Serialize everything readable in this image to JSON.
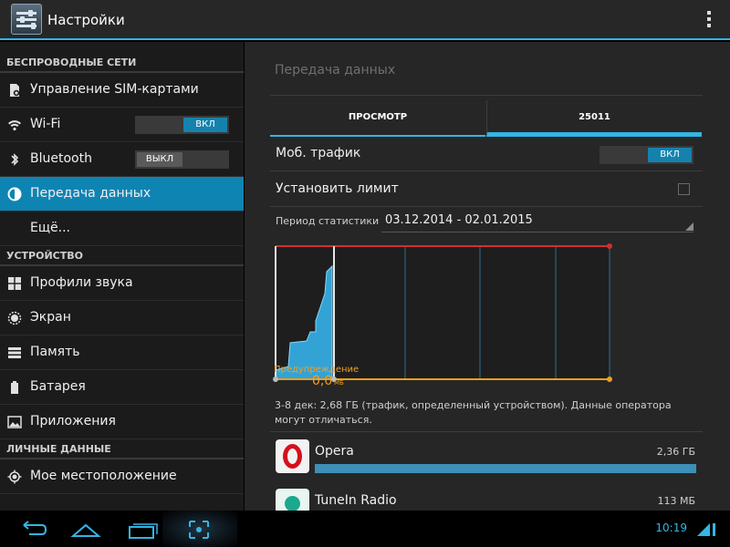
{
  "actionbar": {
    "title": "Настройки"
  },
  "sidebar": {
    "sections": {
      "wireless": "БЕСПРОВОДНЫЕ СЕТИ",
      "device": "УСТРОЙСТВО",
      "personal": "ЛИЧНЫЕ ДАННЫЕ"
    },
    "items": [
      {
        "label": "Управление SIM-картами",
        "icon": "sim-card-icon"
      },
      {
        "label": "Wi-Fi",
        "icon": "wifi-icon",
        "toggle": "ВКЛ"
      },
      {
        "label": "Bluetooth",
        "icon": "bluetooth-icon",
        "toggle": "ВЫКЛ"
      },
      {
        "label": "Передача данных",
        "icon": "data-usage-icon",
        "active": true
      },
      {
        "label": "Ещё..."
      },
      {
        "label": "Профили звука",
        "icon": "sound-profiles-icon"
      },
      {
        "label": "Экран",
        "icon": "display-icon"
      },
      {
        "label": "Память",
        "icon": "storage-icon"
      },
      {
        "label": "Батарея",
        "icon": "battery-icon"
      },
      {
        "label": "Приложения",
        "icon": "apps-icon"
      },
      {
        "label": "Мое местоположение",
        "icon": "location-icon"
      }
    ]
  },
  "main": {
    "title": "Передача данных",
    "tabs": [
      {
        "label": "ПРОСМОТР"
      },
      {
        "label": "25011"
      }
    ],
    "mobile_data": {
      "label": "Моб. трафик",
      "toggle": "ВКЛ"
    },
    "set_limit": {
      "label": "Установить лимит",
      "checked": false
    },
    "period": {
      "label": "Период статистики",
      "value": "03.12.2014 - 02.01.2015"
    },
    "chart": {
      "warning_label": "Предупреждение",
      "warning_value": "0,0",
      "warning_unit": "МБ"
    },
    "note": "3-8 дек: 2,68 ГБ (трафик, определенный устройством). Данные оператора могут отличаться.",
    "apps": [
      {
        "name": "Opera",
        "size": "2,36 ГБ",
        "share": 1.0
      },
      {
        "name": "TuneIn Radio",
        "size": "113 МБ",
        "share": 0.05
      }
    ]
  },
  "navbar": {
    "clock": "10:19"
  },
  "colors": {
    "accent": "#33b5e5",
    "active": "#0e84b3",
    "limit": "#d32f2f",
    "warning": "#f0a020"
  }
}
